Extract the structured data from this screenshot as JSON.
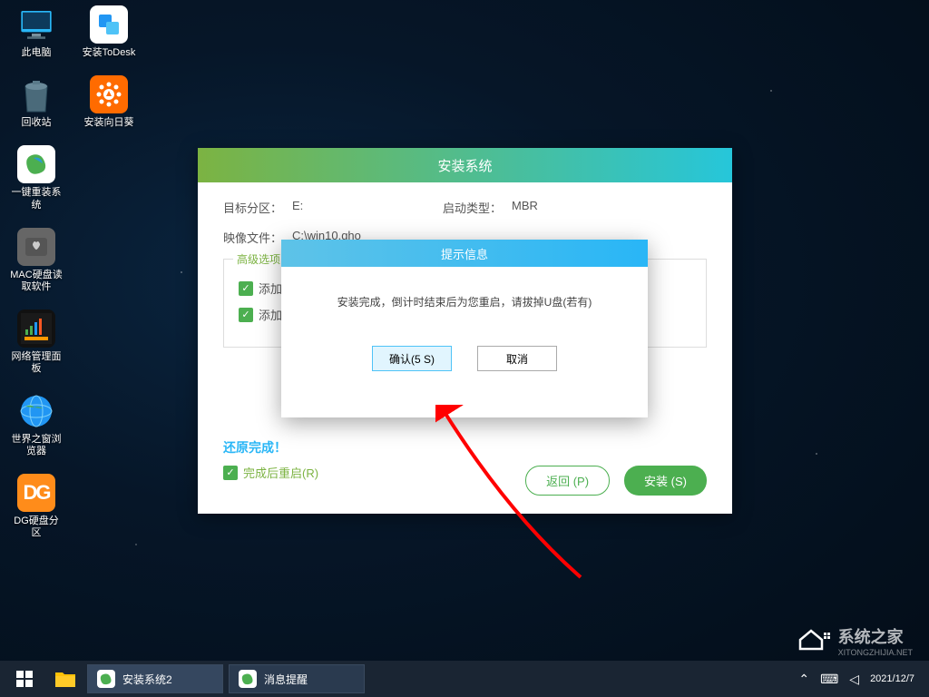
{
  "desktop_icons": {
    "this_pc": "此电脑",
    "todesk": "安装ToDesk",
    "recycle": "回收站",
    "sunflower": "安装向日葵",
    "reinstall": "一键重装系统",
    "mac_disk": "MAC硬盘读取软件",
    "network_panel": "网络管理面板",
    "world_browser": "世界之窗浏览器",
    "dg_partition": "DG硬盘分区"
  },
  "installer": {
    "title": "安装系统",
    "target_partition_label": "目标分区：",
    "target_partition_value": "E:",
    "boot_type_label": "启动类型：",
    "boot_type_value": "MBR",
    "image_file_label": "映像文件：",
    "image_file_value": "C:\\win10.gho",
    "advanced_legend": "高级选项",
    "add_opt1": "添加引导",
    "add_opt2": "添加驱动",
    "restore_done": "还原完成！",
    "restart_after": "完成后重启(R)",
    "back_btn": "返回 (P)",
    "install_btn": "安装 (S)"
  },
  "modal": {
    "title": "提示信息",
    "message": "安装完成，倒计时结束后为您重启，请拔掉U盘(若有)",
    "confirm": "确认(5 S)",
    "cancel": "取消"
  },
  "taskbar": {
    "task1": "安装系统2",
    "task2": "消息提醒",
    "date": "2021/12/7"
  },
  "watermark": {
    "text": "系统之家",
    "url": "XITONGZHIJIA.NET"
  }
}
